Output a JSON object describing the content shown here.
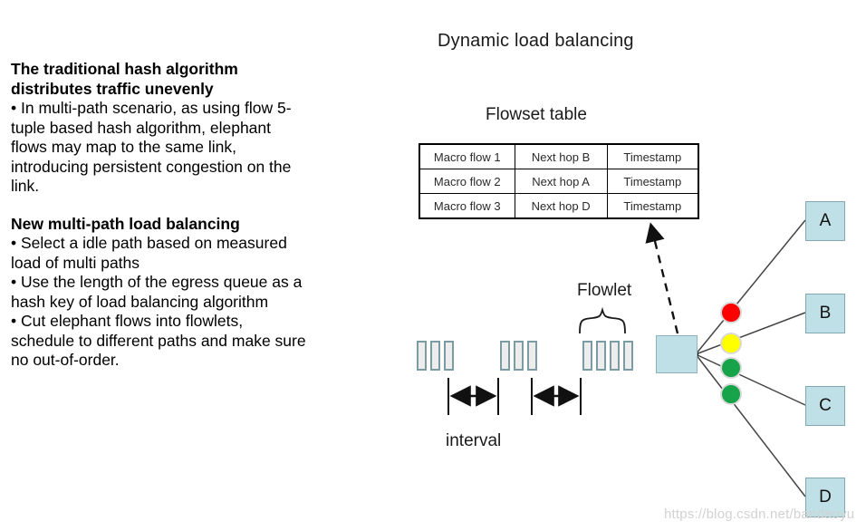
{
  "slide": {
    "title": "Dynamic load balancing"
  },
  "left_panel": {
    "block1": {
      "heading_line1": "The traditional hash algorithm",
      "heading_line2": "distributes traffic unevenly",
      "body_line1": "• In multi-path scenario, as using flow 5-",
      "body_line2": "tuple based hash algorithm, elephant",
      "body_line3": "flows may map to the same link,",
      "body_line4": "introducing persistent congestion on the",
      "body_line5": "link."
    },
    "block2": {
      "heading_line1": "New multi-path load balancing",
      "body_line1": "• Select a idle path based on measured",
      "body_line2": "load of multi paths",
      "body_line3": "• Use the length of the egress queue as a",
      "body_line4": "hash key of load balancing algorithm",
      "body_line5": "• Cut elephant flows into flowlets,",
      "body_line6": "schedule to different paths and make sure",
      "body_line7": "no out-of-order."
    }
  },
  "flowset": {
    "title": "Flowset table",
    "columns": [
      "Macro flow",
      "Next hop",
      "Timestamp"
    ],
    "rows": [
      [
        "Macro flow 1",
        "Next hop B",
        "Timestamp"
      ],
      [
        "Macro flow 2",
        "Next hop A",
        "Timestamp"
      ],
      [
        "Macro flow 3",
        "Next hop D",
        "Timestamp"
      ]
    ]
  },
  "diagram": {
    "flowlet_label": "Flowlet",
    "interval_label": "interval",
    "packet_groups": [
      3,
      3,
      4
    ],
    "status_dots": [
      {
        "name": "queue-status-red",
        "color": "#ff0000"
      },
      {
        "name": "queue-status-yellow",
        "color": "#ffff00"
      },
      {
        "name": "queue-status-green-1",
        "color": "#16a34a"
      },
      {
        "name": "queue-status-green-2",
        "color": "#16a34a"
      }
    ],
    "destinations": [
      {
        "label": "A"
      },
      {
        "label": "B"
      },
      {
        "label": "C"
      },
      {
        "label": "D"
      }
    ],
    "switch_fill": "#bfe0e6",
    "dest_fill": "#bfe0e6",
    "packet_fill": "#ededed",
    "packet_border": "#7c9ca4"
  },
  "watermark": {
    "text": "https://blog.csdn.net/bandaoyu"
  }
}
